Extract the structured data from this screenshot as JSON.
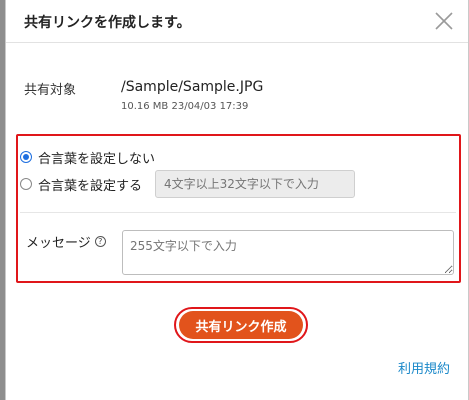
{
  "dialog": {
    "title": "共有リンクを作成します。",
    "close_icon": "close-icon"
  },
  "target": {
    "label": "共有対象",
    "path": "/Sample/Sample.JPG",
    "meta": "10.16 MB 23/04/03 17:39"
  },
  "password": {
    "option_none_label": "合言葉を設定しない",
    "option_set_label": "合言葉を設定する",
    "selected": "none",
    "input_placeholder": "4文字以上32文字以下で入力",
    "input_value": ""
  },
  "message": {
    "label": "メッセージ",
    "help_icon": "help-icon",
    "placeholder": "255文字以下で入力",
    "value": ""
  },
  "actions": {
    "create_label": "共有リンク作成",
    "terms_label": "利用規約"
  },
  "colors": {
    "accent_button": "#e2531c",
    "highlight": "#e0161a",
    "radio_selected": "#1e6fe0",
    "link": "#1a88c9"
  }
}
